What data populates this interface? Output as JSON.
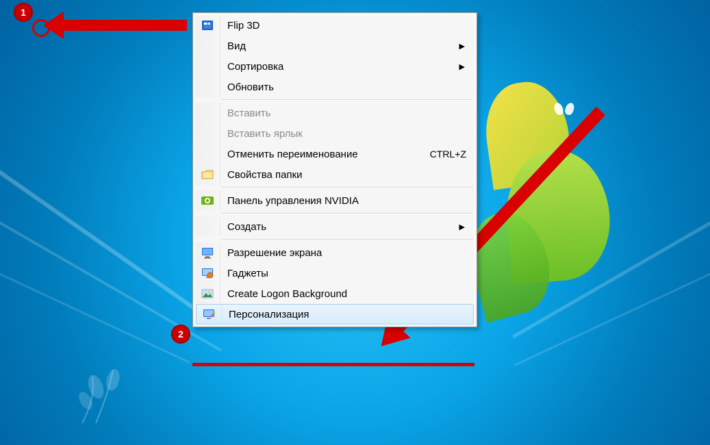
{
  "annotations": {
    "badge1": "1",
    "badge2": "2"
  },
  "menu": {
    "items": [
      {
        "id": "flip3d",
        "label": "Flip 3D",
        "icon": "flip3d-icon",
        "submenu": false,
        "disabled": false,
        "highlight": false,
        "shortcut": ""
      },
      {
        "id": "view",
        "label": "Вид",
        "icon": "",
        "submenu": true,
        "disabled": false,
        "highlight": false,
        "shortcut": ""
      },
      {
        "id": "sort",
        "label": "Сортировка",
        "icon": "",
        "submenu": true,
        "disabled": false,
        "highlight": false,
        "shortcut": ""
      },
      {
        "id": "refresh",
        "label": "Обновить",
        "icon": "",
        "submenu": false,
        "disabled": false,
        "highlight": false,
        "shortcut": ""
      },
      {
        "separator": true
      },
      {
        "id": "paste",
        "label": "Вставить",
        "icon": "",
        "submenu": false,
        "disabled": true,
        "highlight": false,
        "shortcut": ""
      },
      {
        "id": "pastelnk",
        "label": "Вставить ярлык",
        "icon": "",
        "submenu": false,
        "disabled": true,
        "highlight": false,
        "shortcut": ""
      },
      {
        "id": "undo",
        "label": "Отменить переименование",
        "icon": "",
        "submenu": false,
        "disabled": false,
        "highlight": false,
        "shortcut": "CTRL+Z"
      },
      {
        "id": "folderopt",
        "label": "Свойства папки",
        "icon": "folderopt-icon",
        "submenu": false,
        "disabled": false,
        "highlight": false,
        "shortcut": ""
      },
      {
        "separator": true
      },
      {
        "id": "nvidia",
        "label": "Панель управления NVIDIA",
        "icon": "nvidia-icon",
        "submenu": false,
        "disabled": false,
        "highlight": false,
        "shortcut": ""
      },
      {
        "separator": true
      },
      {
        "id": "new",
        "label": "Создать",
        "icon": "",
        "submenu": true,
        "disabled": false,
        "highlight": false,
        "shortcut": ""
      },
      {
        "separator": true
      },
      {
        "id": "screenres",
        "label": "Разрешение экрана",
        "icon": "screenres-icon",
        "submenu": false,
        "disabled": false,
        "highlight": false,
        "shortcut": ""
      },
      {
        "id": "gadgets",
        "label": "Гаджеты",
        "icon": "gadgets-icon",
        "submenu": false,
        "disabled": false,
        "highlight": false,
        "shortcut": ""
      },
      {
        "id": "logonbg",
        "label": "Create Logon Background",
        "icon": "logonbg-icon",
        "submenu": false,
        "disabled": false,
        "highlight": false,
        "shortcut": ""
      },
      {
        "id": "personal",
        "label": "Персонализация",
        "icon": "personal-icon",
        "submenu": false,
        "disabled": false,
        "highlight": true,
        "shortcut": ""
      }
    ]
  }
}
